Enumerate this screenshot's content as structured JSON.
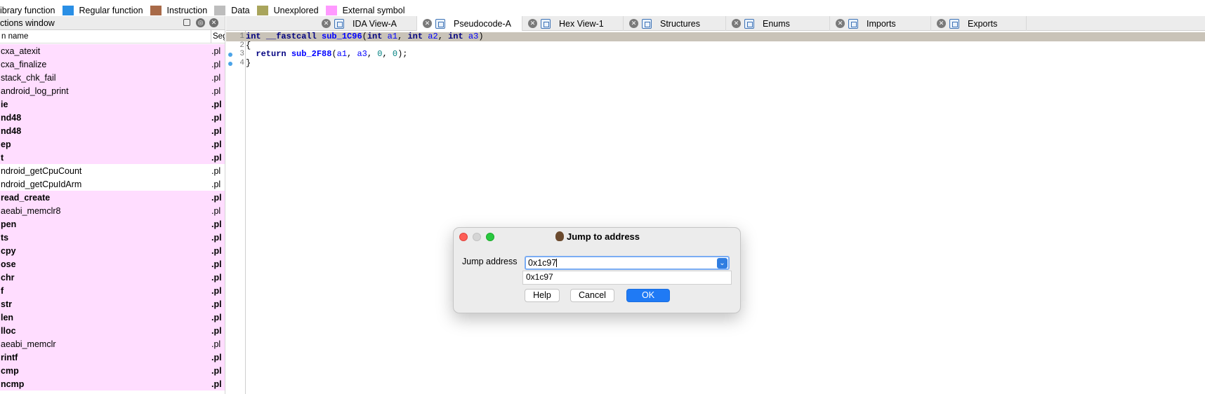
{
  "legend": [
    {
      "label": "ibrary function",
      "color": null
    },
    {
      "label": "Regular function",
      "color": "#2a8fe5"
    },
    {
      "label": "Instruction",
      "color": "#a86a48"
    },
    {
      "label": "Data",
      "color": "#bdbdbd"
    },
    {
      "label": "Unexplored",
      "color": "#a9a55c"
    },
    {
      "label": "External symbol",
      "color": "#ff99ff"
    }
  ],
  "functions_window": {
    "title": "ctions window",
    "col_name": "n name",
    "col_seg": "Seg",
    "rows": [
      {
        "name": "cxa_atexit",
        "seg": ".pl",
        "style": "pink"
      },
      {
        "name": "cxa_finalize",
        "seg": ".pl",
        "style": "pink"
      },
      {
        "name": "stack_chk_fail",
        "seg": ".pl",
        "style": "pink"
      },
      {
        "name": "android_log_print",
        "seg": ".pl",
        "style": "pink"
      },
      {
        "name": "ie",
        "seg": ".pl",
        "style": "pink-bold"
      },
      {
        "name": "nd48",
        "seg": ".pl",
        "style": "pink-bold"
      },
      {
        "name": "nd48",
        "seg": ".pl",
        "style": "pink-bold"
      },
      {
        "name": "ep",
        "seg": ".pl",
        "style": "pink-bold"
      },
      {
        "name": "t",
        "seg": ".pl",
        "style": "pink-bold"
      },
      {
        "name": "ndroid_getCpuCount",
        "seg": ".pl",
        "style": "white"
      },
      {
        "name": "ndroid_getCpuIdArm",
        "seg": ".pl",
        "style": "white"
      },
      {
        "name": "read_create",
        "seg": ".pl",
        "style": "pink-bold"
      },
      {
        "name": "aeabi_memclr8",
        "seg": ".pl",
        "style": "pink"
      },
      {
        "name": "pen",
        "seg": ".pl",
        "style": "pink-bold"
      },
      {
        "name": "ts",
        "seg": ".pl",
        "style": "pink-bold"
      },
      {
        "name": "cpy",
        "seg": ".pl",
        "style": "pink-bold"
      },
      {
        "name": "ose",
        "seg": ".pl",
        "style": "pink-bold"
      },
      {
        "name": "chr",
        "seg": ".pl",
        "style": "pink-bold"
      },
      {
        "name": "f",
        "seg": ".pl",
        "style": "pink-bold"
      },
      {
        "name": "str",
        "seg": ".pl",
        "style": "pink-bold"
      },
      {
        "name": "len",
        "seg": ".pl",
        "style": "pink-bold"
      },
      {
        "name": "lloc",
        "seg": ".pl",
        "style": "pink-bold"
      },
      {
        "name": "aeabi_memclr",
        "seg": ".pl",
        "style": "pink"
      },
      {
        "name": "rintf",
        "seg": ".pl",
        "style": "pink-bold"
      },
      {
        "name": "cmp",
        "seg": ".pl",
        "style": "pink-bold"
      },
      {
        "name": "ncmp",
        "seg": ".pl",
        "style": "pink-bold"
      }
    ]
  },
  "tabs": [
    {
      "label": "IDA View-A",
      "active": false,
      "icon": "ida-view-icon"
    },
    {
      "label": "Pseudocode-A",
      "active": true,
      "icon": "pseudocode-icon"
    },
    {
      "label": "Hex View-1",
      "active": false,
      "icon": "hex-view-icon"
    },
    {
      "label": "Structures",
      "active": false,
      "icon": "structures-icon"
    },
    {
      "label": "Enums",
      "active": false,
      "icon": "enums-icon"
    },
    {
      "label": "Imports",
      "active": false,
      "icon": "imports-icon"
    },
    {
      "label": "Exports",
      "active": false,
      "icon": "exports-icon"
    }
  ],
  "code": {
    "lines": [
      {
        "num": "1",
        "text": "int __fastcall sub_1C96(int a1, int a2, int a3)",
        "dot": false,
        "highlight": true
      },
      {
        "num": "2",
        "text": "{",
        "dot": false,
        "highlight": false
      },
      {
        "num": "3",
        "text": "  return sub_2F88(a1, a3, 0, 0);",
        "dot": true,
        "highlight": false
      },
      {
        "num": "4",
        "text": "}",
        "dot": true,
        "highlight": false
      }
    ]
  },
  "dialog": {
    "title": "Jump to address",
    "label": "Jump address",
    "input_value": "0x1c97",
    "dropdown_option": "0x1c97",
    "help": "Help",
    "cancel": "Cancel",
    "ok": "OK"
  }
}
